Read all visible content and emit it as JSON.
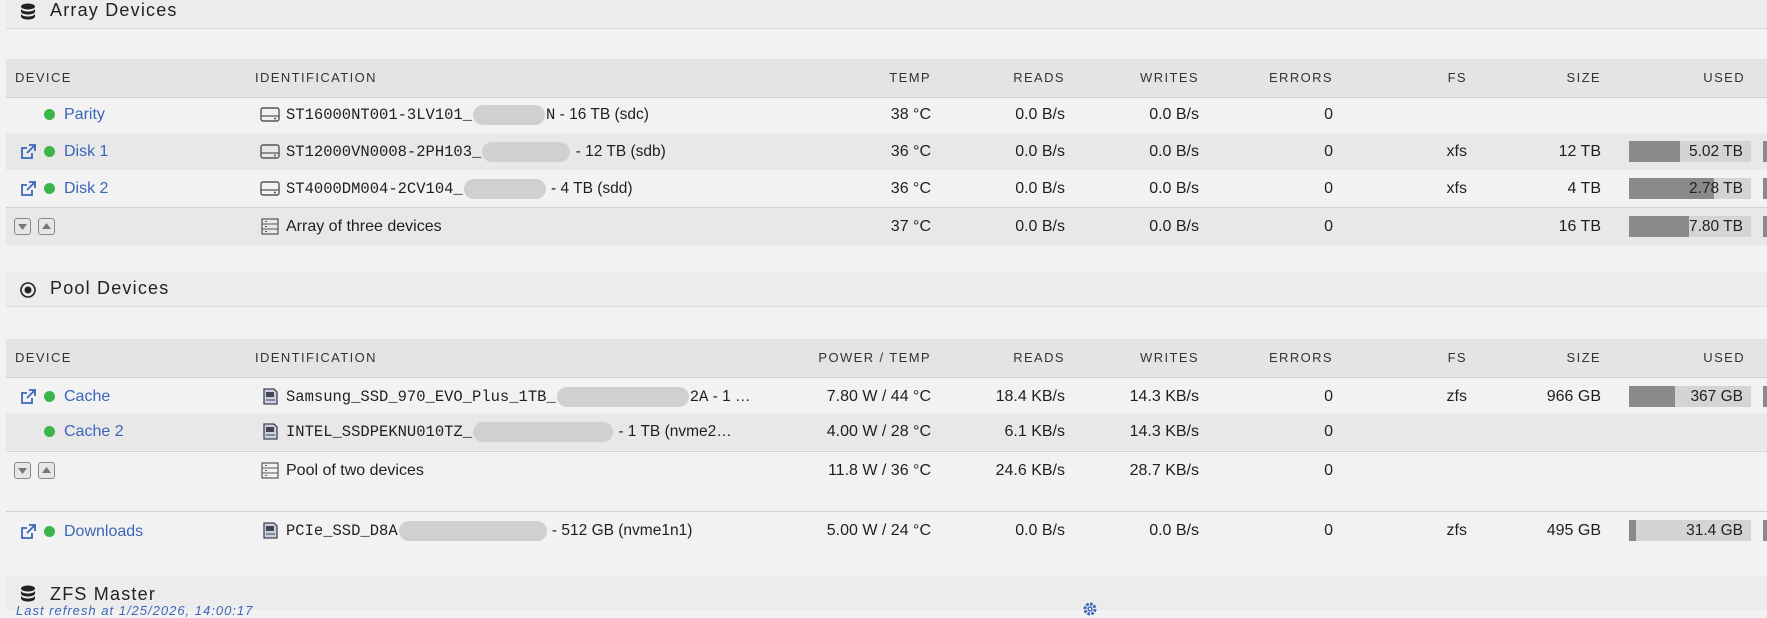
{
  "array": {
    "title": "Array Devices",
    "headers": {
      "device": "DEVICE",
      "identification": "IDENTIFICATION",
      "temp": "TEMP",
      "reads": "READS",
      "writes": "WRITES",
      "errors": "ERRORS",
      "fs": "FS",
      "size": "SIZE",
      "used": "USED"
    },
    "rows": [
      {
        "name": "Parity",
        "id_a": "ST16000NT001-3LV101_",
        "id_b": "N",
        "id_tail": " - 16 TB (sdc)",
        "temp": "38 °C",
        "reads": "0.0 B/s",
        "writes": "0.0 B/s",
        "errors": "0",
        "fs": "",
        "size": "",
        "used": ""
      },
      {
        "name": "Disk 1",
        "id_a": "ST12000VN0008-2PH103_",
        "id_b": "",
        "id_tail": " - 12 TB (sdb)",
        "temp": "36 °C",
        "reads": "0.0 B/s",
        "writes": "0.0 B/s",
        "errors": "0",
        "fs": "xfs",
        "size": "12 TB",
        "used": "5.02 TB",
        "used_fraction": 0.42
      },
      {
        "name": "Disk 2",
        "id_a": "ST4000DM004-2CV104_",
        "id_b": "",
        "id_tail": " - 4 TB (sdd)",
        "temp": "36 °C",
        "reads": "0.0 B/s",
        "writes": "0.0 B/s",
        "errors": "0",
        "fs": "xfs",
        "size": "4 TB",
        "used": "2.78 TB",
        "used_fraction": 0.7
      },
      {
        "name": "",
        "id_a": "Array of three devices",
        "temp": "37 °C",
        "reads": "0.0 B/s",
        "writes": "0.0 B/s",
        "errors": "0",
        "fs": "",
        "size": "16 TB",
        "used": "7.80 TB",
        "used_fraction": 0.49
      }
    ]
  },
  "pool": {
    "title": "Pool Devices",
    "headers": {
      "device": "DEVICE",
      "identification": "IDENTIFICATION",
      "power_temp": "POWER / TEMP",
      "reads": "READS",
      "writes": "WRITES",
      "errors": "ERRORS",
      "fs": "FS",
      "size": "SIZE",
      "used": "USED"
    },
    "rows": [
      {
        "name": "Cache",
        "id_a": "Samsung_SSD_970_EVO_Plus_1TB_",
        "id_b": "2A",
        "id_tail": " - 1 …",
        "power_temp": "7.80 W / 44 °C",
        "reads": "18.4 KB/s",
        "writes": "14.3 KB/s",
        "errors": "0",
        "fs": "zfs",
        "size": "966 GB",
        "used": "367 GB",
        "used_fraction": 0.38
      },
      {
        "name": "Cache 2",
        "id_a": "INTEL_SSDPEKNU010TZ_",
        "id_b": "",
        "id_tail": " - 1 TB (nvme2…",
        "power_temp": "4.00 W / 28 °C",
        "reads": "6.1 KB/s",
        "writes": "14.3 KB/s",
        "errors": "0",
        "fs": "",
        "size": "",
        "used": ""
      },
      {
        "name": "",
        "id_a": "Pool of two devices",
        "power_temp": "11.8 W / 36 °C",
        "reads": "24.6 KB/s",
        "writes": "28.7 KB/s",
        "errors": "0"
      },
      {
        "name": "Downloads",
        "id_a": "PCIe_SSD_D8A",
        "id_b": "",
        "id_tail": " - 512 GB (nvme1n1)",
        "power_temp": "5.00 W / 24 °C",
        "reads": "0.0 B/s",
        "writes": "0.0 B/s",
        "errors": "0",
        "fs": "zfs",
        "size": "495 GB",
        "used": "31.4 GB",
        "used_fraction": 0.06
      }
    ]
  },
  "zfs": {
    "title": "ZFS Master",
    "last_refresh": "Last refresh at 1/25/2026, 14:00:17"
  },
  "colors": {
    "link": "#3b66b8",
    "status_ok": "#3cb44a",
    "bar_fill": "#8a8a8a",
    "bar_track": "#d4d4d4"
  },
  "icons": {
    "array_title": "database-icon",
    "pool_title": "target-icon",
    "zfs_title": "database-icon",
    "device_link": "external-link-icon",
    "hdd": "hard-drive-icon",
    "nvme": "nvme-drive-icon",
    "group": "list-icon",
    "gear": "gear-icon"
  }
}
